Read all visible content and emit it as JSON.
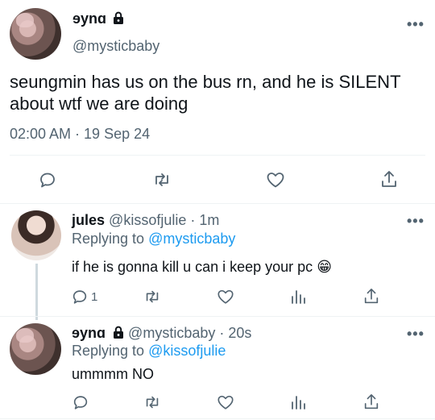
{
  "main_tweet": {
    "display_name": "ɘynɑ",
    "handle": "@mysticbaby",
    "text": "seungmin has us on the bus rn, and he is SILENT about wtf we are doing",
    "timestamp": "02:00 AM · 19 Sep 24",
    "more_icon": "•••"
  },
  "reply1": {
    "display_name": "jules",
    "handle": "@kissofjulie",
    "separator": "·",
    "time": "1m",
    "replying_prefix": "Replying to",
    "replying_to": "@mysticbaby",
    "text": "if he is gonna kill u can i keep your pc",
    "emoji": "😁",
    "reply_count": "1",
    "more_icon": "•••"
  },
  "reply2": {
    "display_name": "ɘynɑ",
    "handle": "@mysticbaby",
    "separator": "·",
    "time": "20s",
    "replying_prefix": "Replying to",
    "replying_to": "@kissofjulie",
    "text": "ummmm NO",
    "more_icon": "•••"
  },
  "colors": {
    "text": "#0f1419",
    "secondary": "#536471",
    "link": "#1d9bf0",
    "divider": "#eff3f4",
    "thread_line": "#cfd9de"
  }
}
